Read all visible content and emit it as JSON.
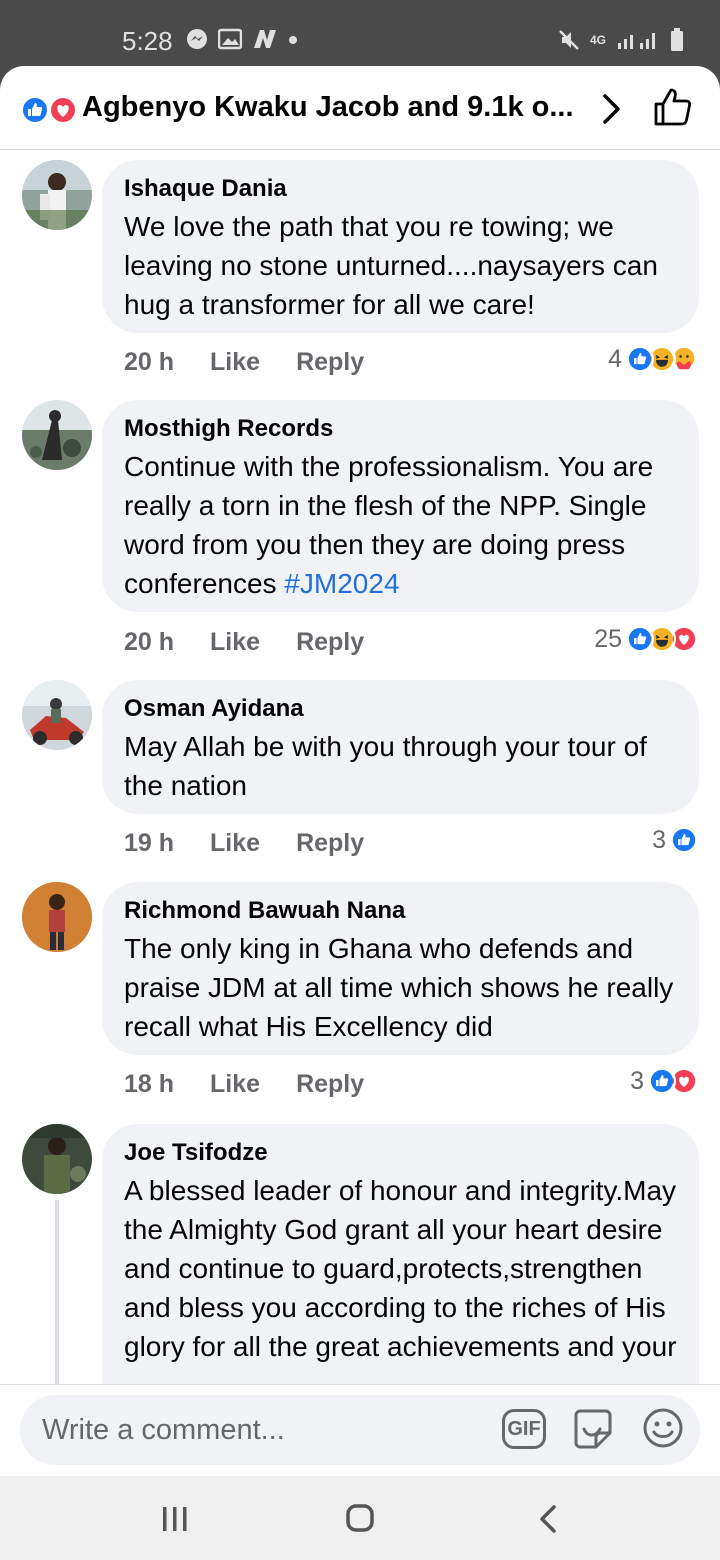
{
  "status_bar": {
    "time": "5:28",
    "network": "4G"
  },
  "header": {
    "title": "Agbenyo Kwaku Jacob and 9.1k o..."
  },
  "comments": [
    {
      "author": "Ishaque Dania",
      "text": "We love the path that you re towing; we leaving no stone unturned....naysayers can hug a transformer for all we care!",
      "time": "20 h",
      "like_label": "Like",
      "reply_label": "Reply",
      "reaction_count": "4",
      "reactions": [
        "like",
        "haha",
        "care"
      ]
    },
    {
      "author": "Mosthigh Records",
      "text": "Continue with the professionalism. You are really a torn in the flesh of the NPP. Single word from you then they are doing press conferences ",
      "hashtag": "#JM2024",
      "time": "20 h",
      "like_label": "Like",
      "reply_label": "Reply",
      "reaction_count": "25",
      "reactions": [
        "like",
        "haha",
        "love"
      ]
    },
    {
      "author": "Osman Ayidana",
      "text": "May Allah be with you through your tour of the nation",
      "time": "19 h",
      "like_label": "Like",
      "reply_label": "Reply",
      "reaction_count": "3",
      "reactions": [
        "like"
      ]
    },
    {
      "author": "Richmond Bawuah Nana",
      "text": "The only king in Ghana who defends and praise JDM at all time which shows he really recall what His Excellency did",
      "time": "18 h",
      "like_label": "Like",
      "reply_label": "Reply",
      "reaction_count": "3",
      "reactions": [
        "like",
        "love"
      ]
    },
    {
      "author": "Joe Tsifodze",
      "text": "A blessed leader of honour and integrity.May the Almighty God grant all your heart desire and continue to guard,protects,strengthen and bless you according to the riches of His glory for all the great achievements and your"
    }
  ],
  "composer": {
    "placeholder": "Write a comment...",
    "gif_label": "GIF"
  },
  "colors": {
    "like_blue": "#1877f2",
    "love_red": "#f33e58",
    "haha_yellow": "#f7b125",
    "hashtag_blue": "#216fdb",
    "bubble_gray": "#f0f2f5"
  }
}
